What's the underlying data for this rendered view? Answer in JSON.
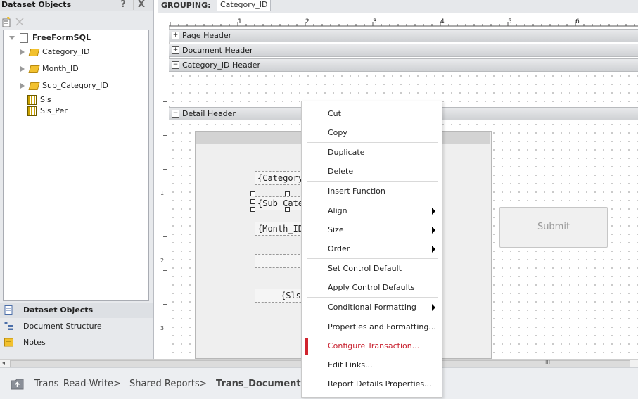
{
  "left_panel": {
    "title": "Dataset Objects",
    "help_label": "?",
    "close_label": "X",
    "tree": {
      "root": "FreeFormSQL",
      "attributes": [
        "Category_ID",
        "Month_ID",
        "Sub_Category_ID"
      ],
      "metrics": [
        "Sls",
        "Sls_Per"
      ]
    },
    "nav": [
      "Dataset Objects",
      "Document Structure",
      "Notes"
    ]
  },
  "grouping": {
    "label": "GROUPING:",
    "value": "Category_ID"
  },
  "ruler": {
    "numbers": [
      "1",
      "2",
      "3",
      "4",
      "5",
      "6"
    ],
    "vnumbers": [
      "1",
      "2",
      "3"
    ]
  },
  "sections": {
    "page_header": "Page Header",
    "document_header": "Document Header",
    "category_header": "Category_ID Header",
    "detail_header": "Detail Header",
    "expand_symbol": "+",
    "collapse_symbol": "−"
  },
  "canvas": {
    "fields": [
      "{Category_",
      "{Sub_Cate",
      "{Month_ID",
      "",
      "{Sls_"
    ],
    "submit_label": "Submit"
  },
  "context_menu": {
    "items": [
      "Cut",
      "Copy",
      "Duplicate",
      "Delete",
      "Insert Function",
      "Align",
      "Size",
      "Order",
      "Set Control Default",
      "Apply Control Defaults",
      "Conditional Formatting",
      "Properties and Formatting...",
      "Configure Transaction...",
      "Edit Links...",
      "Report Details Properties..."
    ]
  },
  "scrollbar": {
    "grip": "III"
  },
  "breadcrumb": {
    "items": [
      "Trans_Read-Write",
      "Shared Reports",
      "Trans_Document"
    ],
    "separator": ">"
  },
  "colors": {
    "accent_red": "#c8202e",
    "cube_yellow": "#f2c12e"
  },
  "icons": [
    "folder-up-icon",
    "cube-icon",
    "metric-icon",
    "document-icon"
  ]
}
